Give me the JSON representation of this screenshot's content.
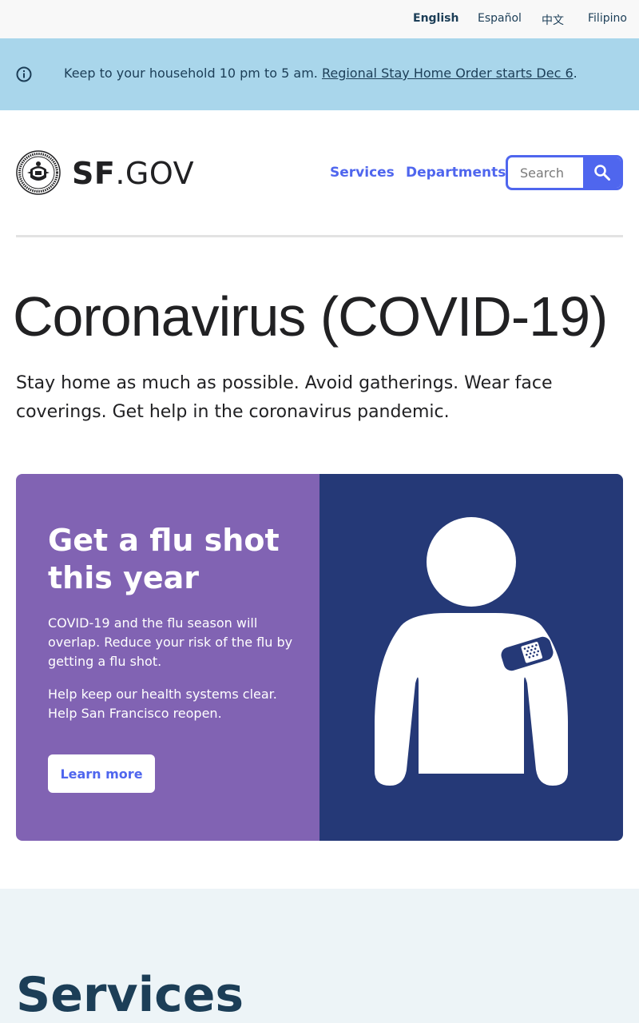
{
  "languages": {
    "english": "English",
    "espanol": "Español",
    "chinese": "中文",
    "filipino": "Filipino",
    "active": "English"
  },
  "alert": {
    "icon": "info-icon",
    "text": "Keep to your household 10 pm to 5 am. ",
    "link_text": "Regional Stay Home Order starts Dec 6",
    "trailing": "."
  },
  "header": {
    "logo_icon": "city-seal-icon",
    "brand_sf": "SF",
    "brand_gov": ".GOV",
    "nav": {
      "services": "Services",
      "departments": "Departments"
    },
    "search": {
      "placeholder": "Search",
      "icon": "search-icon"
    }
  },
  "page": {
    "title": "Coronavirus (COVID-19)",
    "description": "Stay home as much as possible. Avoid gatherings. Wear face coverings. Get help in the coronavirus pandemic."
  },
  "flu_card": {
    "title": "Get a flu shot this year",
    "paragraph1": "COVID-19 and the flu season will overlap. Reduce your risk of the flu by getting a flu shot.",
    "paragraph2": "Help keep our health systems clear. Help San Francisco reopen.",
    "button": "Learn more",
    "illustration": "person-with-bandage-icon"
  },
  "services_section": {
    "title": "Services"
  },
  "colors": {
    "accent_blue": "#4f66ee",
    "alert_bg": "#a9d6eb",
    "card_purple": "#8163b3",
    "card_navy": "#253977",
    "dark_navy_text": "#1c3e57",
    "services_bg": "#edf4f7"
  }
}
